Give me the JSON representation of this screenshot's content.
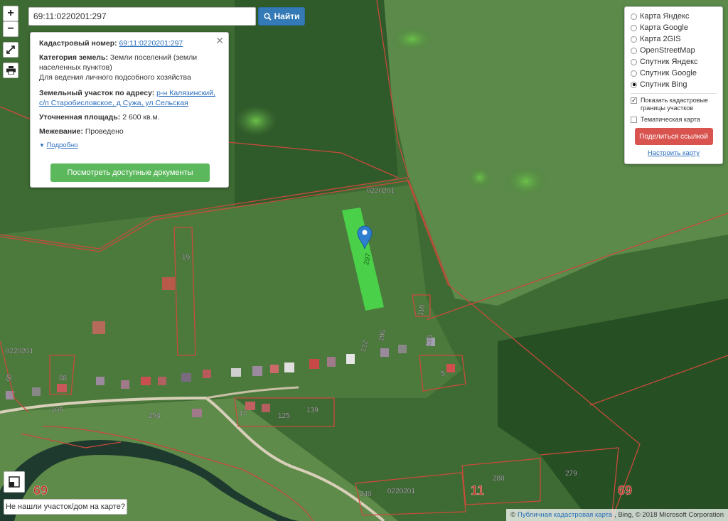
{
  "search": {
    "value": "69:11:0220201:297",
    "button_label": "Найти"
  },
  "controls": {
    "zoom_in": "+",
    "zoom_out": "−"
  },
  "info": {
    "cadastral_label": "Кадастровый номер:",
    "cadastral_value": "69:11:0220201:297",
    "category_label": "Категория земель:",
    "category_value": "Земли поселений (земли населенных пунктов)",
    "usage": "Для ведения личного подсобного хозяйства",
    "address_label": "Земельный участок по адресу:",
    "address_value": "р-н Калязинский, с/п Старобисловское, д Сужа, ул Сельская",
    "area_label": "Уточненная площадь:",
    "area_value": "2 600 кв.м.",
    "survey_label": "Межевание:",
    "survey_value": "Проведено",
    "more_link": "Подробно",
    "docs_button": "Посмотреть доступные документы"
  },
  "layers": {
    "options": [
      {
        "label": "Карта Яндекс",
        "selected": false
      },
      {
        "label": "Карта Google",
        "selected": false
      },
      {
        "label": "Карта 2GIS",
        "selected": false
      },
      {
        "label": "OpenStreetMap",
        "selected": false
      },
      {
        "label": "Спутник Яндекс",
        "selected": false
      },
      {
        "label": "Спутник Google",
        "selected": false
      },
      {
        "label": "Спутник Bing",
        "selected": true
      }
    ],
    "checkbox_cadastral": "Показать кадастровые границы участков",
    "checkbox_thematic": "Тематическая карта",
    "share_button": "Поделиться ссылкой",
    "setup_link": "Настроить карту"
  },
  "map_labels": {
    "quarter_top": "0220201",
    "quarter_left": "0220201",
    "quarter_bottom": "0220201",
    "plot_19": "19",
    "plot_88": "88",
    "plot_105": "105",
    "plot_253": "253",
    "plot_47": "47",
    "plot_125": "125",
    "plot_139": "139",
    "plot_240": "240",
    "plot_280": "280",
    "plot_279": "279",
    "plot_5": "5",
    "plot_296": "296",
    "plot_122": "122",
    "plot_110": "110",
    "plot_135": "135",
    "plot_92": "92",
    "region_left": "69",
    "region_right": "69",
    "district": "11",
    "selected_plot": "297"
  },
  "notfound_button": "Не нашли участок/дом на карте?",
  "attribution": {
    "copyright": "©",
    "link": "Публичная кадастровая карта",
    "rest": ", Bing, © 2018 Microsoft Corporation"
  },
  "colors": {
    "selected_plot": "#4be04b",
    "boundary": "#c84b3c",
    "marker": "#2f7fd0"
  },
  "icons": [
    "plus-icon",
    "minus-icon",
    "fullscreen-icon",
    "print-icon",
    "search-icon",
    "close-icon",
    "triangle-down-icon",
    "map-marker-icon",
    "layers-icon"
  ]
}
